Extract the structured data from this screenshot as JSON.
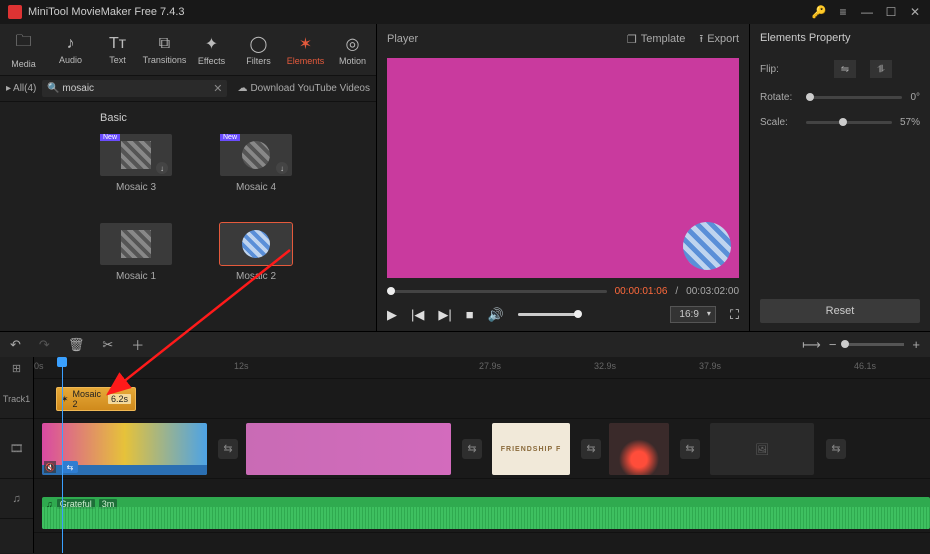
{
  "app_title": "MiniTool MovieMaker Free 7.4.3",
  "toolbar": {
    "media": "Media",
    "audio": "Audio",
    "text": "Text",
    "transitions": "Transitions",
    "effects": "Effects",
    "filters": "Filters",
    "elements": "Elements",
    "motion": "Motion"
  },
  "browse": {
    "all_label": "All(4)",
    "search_value": "mosaic",
    "download_label": "Download YouTube Videos",
    "category_label": "Basic",
    "items": [
      {
        "name": "Mosaic 3",
        "new": true
      },
      {
        "name": "Mosaic 4",
        "new": true
      },
      {
        "name": "Mosaic 1",
        "new": false
      },
      {
        "name": "Mosaic 2",
        "new": false
      }
    ],
    "new_badge": "New"
  },
  "player": {
    "title": "Player",
    "template_label": "Template",
    "export_label": "Export",
    "current_time": "00:00:01:06",
    "total_time": "00:03:02:00",
    "ratio": "16:9"
  },
  "properties": {
    "title": "Elements Property",
    "flip_label": "Flip:",
    "rotate_label": "Rotate:",
    "rotate_value": "0°",
    "scale_label": "Scale:",
    "scale_value": "57%",
    "reset_label": "Reset"
  },
  "timeline": {
    "ruler": [
      "0s",
      "12s",
      "27.9s",
      "32.9s",
      "37.9s",
      "46.1s"
    ],
    "track1_label": "Track1",
    "element_clip_name": "Mosaic 2",
    "element_clip_duration": "6.2s",
    "audio_clip_name": "Grateful",
    "audio_clip_duration": "3m",
    "video_clip_4_label": "FRIENDSHIP F"
  }
}
